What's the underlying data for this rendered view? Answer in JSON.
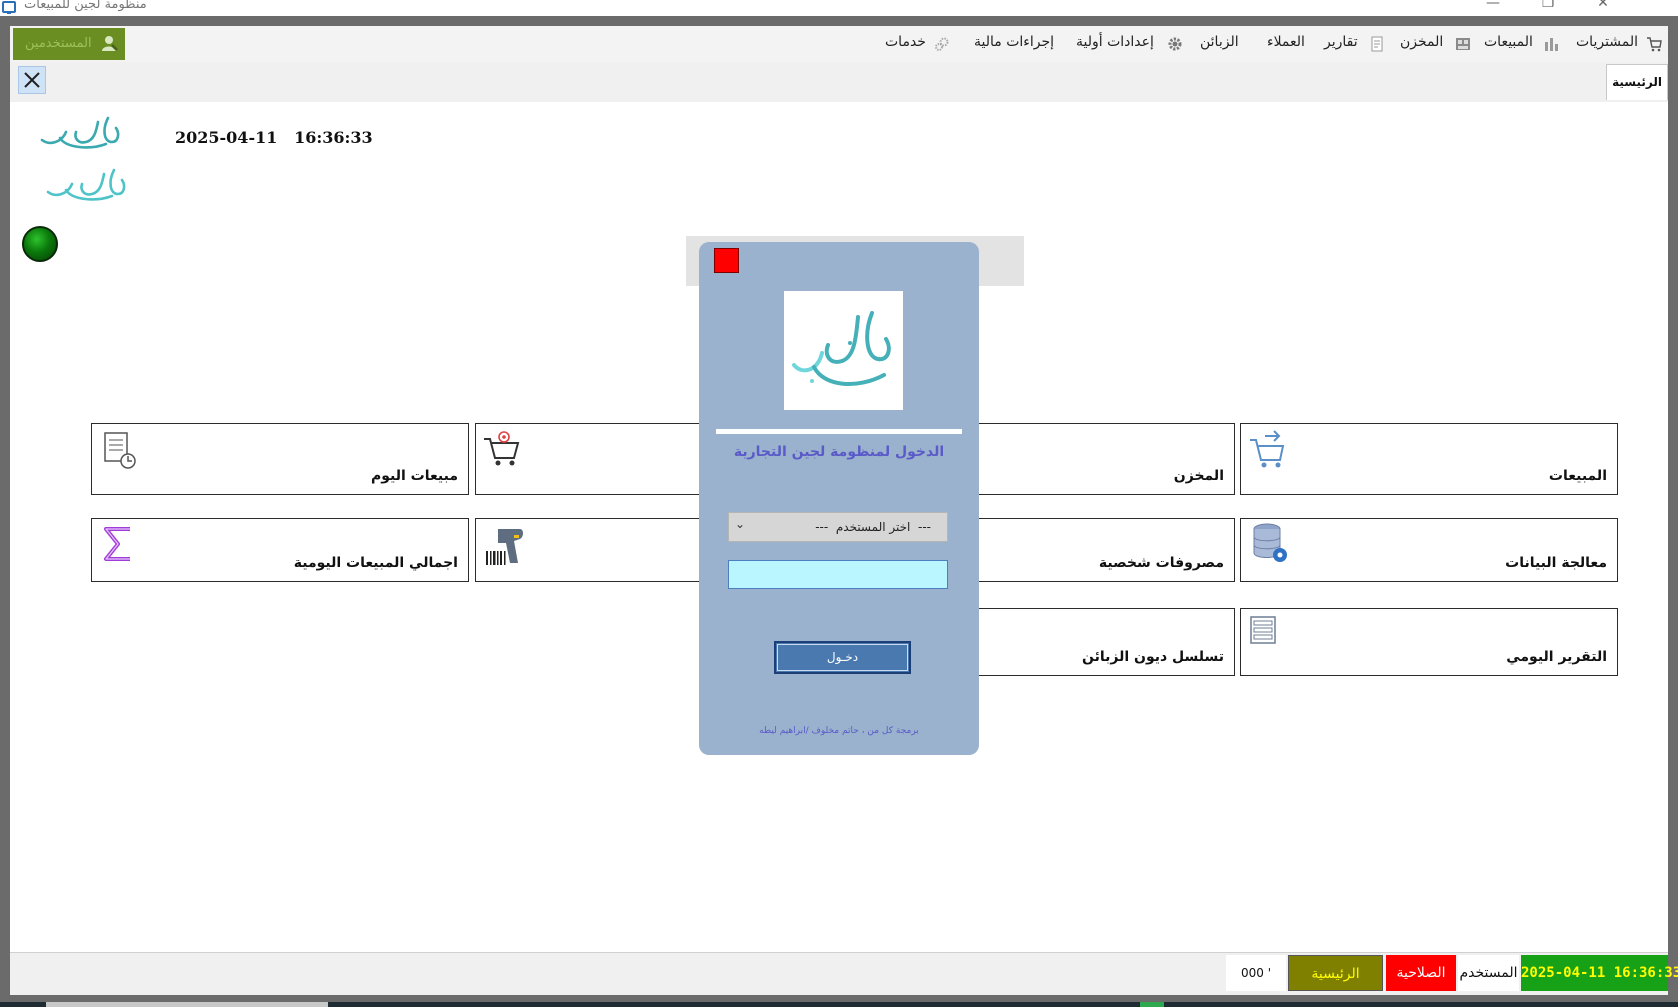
{
  "window": {
    "title": "منظومة لجين للمبيعات",
    "minimize_glyph": "—",
    "maximize_glyph": "❐",
    "close_glyph": "✕"
  },
  "menubar": {
    "users_label": "المستخدمين",
    "items": [
      {
        "label": "المشتريات",
        "icon": "cart-icon"
      },
      {
        "label": "المبيعات",
        "icon": "chart-icon"
      },
      {
        "label": "المخزن",
        "icon": "store-icon"
      },
      {
        "label": "تقارير",
        "icon": "report-icon"
      },
      {
        "label": "العملاء",
        "icon": ""
      },
      {
        "label": "الزبائن",
        "icon": ""
      },
      {
        "label": "إعدادات أولية",
        "icon": "gear-icon"
      },
      {
        "label": "إجراءات مالية",
        "icon": ""
      },
      {
        "label": "خدمات",
        "icon": "gears-icon"
      }
    ]
  },
  "tabs": {
    "active": "الرئيسية",
    "close_glyph": "✕"
  },
  "main": {
    "date": "2025-04-11",
    "time": "16:36:33"
  },
  "cards": {
    "sales": "المبيعات",
    "store": "المخزن",
    "today_sales": "مبيعات اليوم",
    "data_processing": "معالجة البيانات",
    "personal_expenses": "مصروفات شخصية",
    "daily_sales_total": "اجمالي المبيعات اليومية",
    "daily_report": "التقرير اليومي",
    "customer_debts": "تسلسل ديون الزبائن"
  },
  "login_dialog": {
    "title": "الدخول لمنظومة لجين التجارية",
    "user_select_placeholder": "---  اختر المستخدم  ---",
    "login_button": "دخـول",
    "credit": "برمجة كل من ، حاتم مخلوف /ابراهيم ليطه"
  },
  "statusbar": {
    "datetime": "2025-04-11 16:36:33",
    "user_label": "المستخدم",
    "permission_label": "الصلاحية",
    "home_label": "الرئيسية",
    "code": "000",
    "mark": "'",
    "colors": {
      "datetime_bg": "#16a116",
      "datetime_fg": "#ffff00",
      "permission_bg": "#ff0000",
      "home_bg": "#7f7f00",
      "home_fg": "#ffff00"
    }
  }
}
